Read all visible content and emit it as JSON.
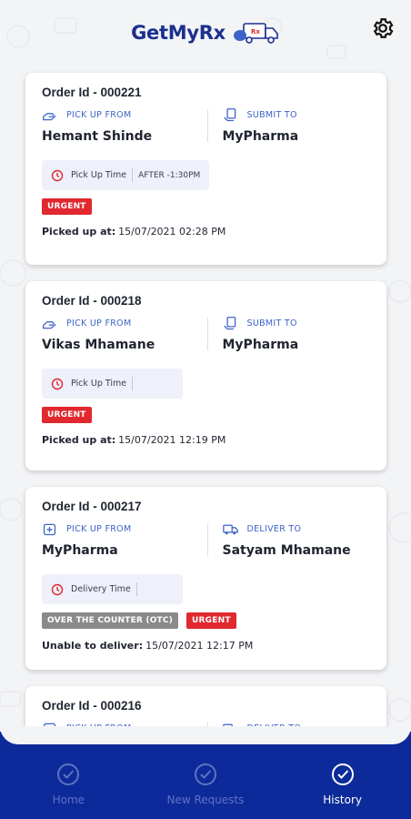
{
  "app": {
    "logo_text": "GetMyRx",
    "logo_truck_text": "Rx"
  },
  "orders": [
    {
      "order_id": "Order Id - 000221",
      "left_label": "PICK UP FROM",
      "left_value": "Hemant Shinde",
      "right_label": "SUBMIT TO",
      "right_value": "MyPharma",
      "time_label": "Pick Up Time",
      "time_value": "AFTER -1:30PM",
      "badges": [
        "URGENT"
      ],
      "status_label": "Picked up at:",
      "status_value": "15/07/2021 02:28 PM"
    },
    {
      "order_id": "Order Id - 000218",
      "left_label": "PICK UP FROM",
      "left_value": "Vikas Mhamane",
      "right_label": "SUBMIT TO",
      "right_value": "MyPharma",
      "time_label": "Pick Up Time",
      "time_value": "",
      "badges": [
        "URGENT"
      ],
      "status_label": "Picked up at:",
      "status_value": "15/07/2021 12:19 PM"
    },
    {
      "order_id": "Order Id - 000217",
      "left_label": "PICK UP FROM",
      "left_value": "MyPharma",
      "right_label": "DELIVER TO",
      "right_value": "Satyam Mhamane",
      "time_label": "Delivery Time",
      "time_value": "",
      "badges": [
        "OVER THE COUNTER (OTC)",
        "URGENT"
      ],
      "status_label": "Unable to deliver:",
      "status_value": "15/07/2021 12:17 PM"
    },
    {
      "order_id": "Order Id - 000216",
      "left_label": "PICK UP FROM",
      "right_label": "DELIVER TO"
    }
  ],
  "nav": {
    "home": "Home",
    "new_requests": "New Requests",
    "history": "History"
  },
  "colors": {
    "brand": "#1a2f8f",
    "nav_bg": "#0c2a9a",
    "urgent": "#e0282e",
    "otc": "#8a8a8a",
    "label_blue": "#3d63c8"
  }
}
